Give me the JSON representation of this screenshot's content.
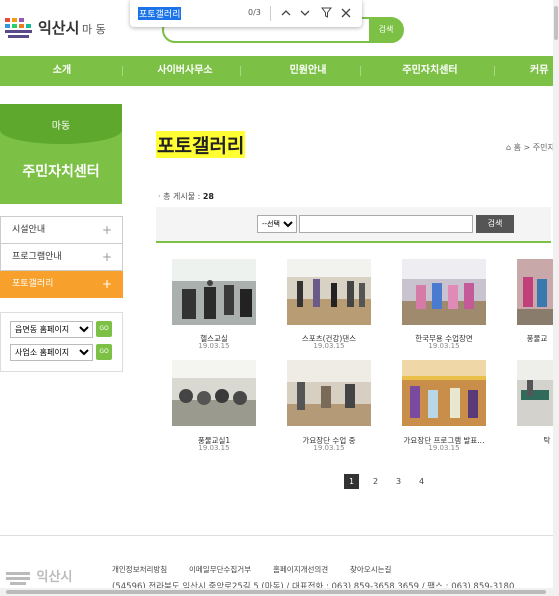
{
  "header": {
    "city": "익산시",
    "dong": "마 동",
    "search_button": "검색"
  },
  "findbar": {
    "query": "포토갤러리",
    "count": "0/3",
    "up_icon": "chevron-up-icon",
    "down_icon": "chevron-down-icon",
    "filter_icon": "filter-icon",
    "close_icon": "close-icon"
  },
  "nav": {
    "items": [
      {
        "label": "소개"
      },
      {
        "label": "사이버사무소"
      },
      {
        "label": "민원안내"
      },
      {
        "label": "주민자치센터"
      },
      {
        "label": "커뮤"
      }
    ]
  },
  "sidebar": {
    "dong": "마동",
    "title": "주민자치센터",
    "menu": [
      {
        "label": "시설안내",
        "active": false
      },
      {
        "label": "프로그램안내",
        "active": false
      },
      {
        "label": "포토갤러리",
        "active": true
      }
    ],
    "quick": [
      {
        "label": "읍면동 홈페이지",
        "go": "GO"
      },
      {
        "label": "사업소 홈페이지",
        "go": "GO"
      }
    ]
  },
  "page": {
    "title": "포토갤러리",
    "breadcrumb_home": "홈",
    "breadcrumb_sep": ">",
    "breadcrumb_next": "주민자",
    "count_label": "· 총 게시물 :",
    "count_value": "28"
  },
  "search": {
    "select_label": "--선택--",
    "button": "검색"
  },
  "gallery": [
    {
      "title": "헬스교실",
      "date": "19.03.15"
    },
    {
      "title": "스포츠(건강)댄스",
      "date": "19.03.15"
    },
    {
      "title": "한국무용 수업장면",
      "date": "19.03.15"
    },
    {
      "title": "풍물교",
      "date": ""
    },
    {
      "title": "풍물교실1",
      "date": "19.03.15"
    },
    {
      "title": "가요장단 수업 중",
      "date": "19.03.15"
    },
    {
      "title": "가요장단 프로그램 발표...",
      "date": "19.03.15"
    },
    {
      "title": "탁",
      "date": ""
    }
  ],
  "pagination": {
    "pages": [
      "1",
      "2",
      "3",
      "4"
    ],
    "current": "1"
  },
  "footer": {
    "logo": "익산시",
    "links": [
      "개인정보처리방침",
      "이메일무단수집거부",
      "홈페이지개선의견",
      "찾아오시는길"
    ],
    "address": "(54596) 전라북도 익산시 중앙로25길 5 (마동) / 대표전화 : 063) 859-3658,3659 / 팩스 : 063) 859-3180"
  },
  "colors": {
    "green": "#7cc145",
    "orange": "#f7a02c",
    "highlight": "#ffff33"
  }
}
